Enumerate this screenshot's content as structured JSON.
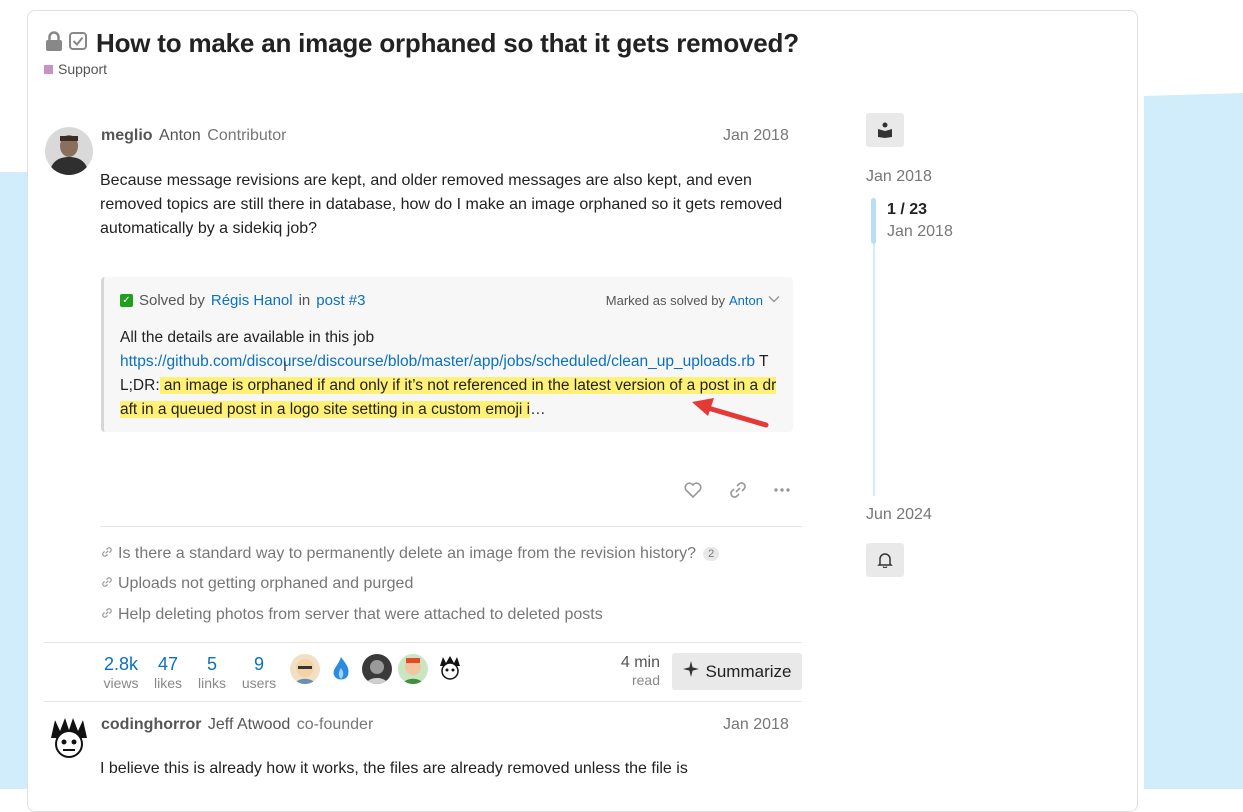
{
  "topic": {
    "title": "How to make an image orphaned so that it gets removed?",
    "category": "Support",
    "category_color": "#c891c8"
  },
  "post1": {
    "username": "meglio",
    "full_name": "Anton",
    "user_title": "Contributor",
    "date": "Jan 2018",
    "body": "Because message revisions are kept, and older removed messages are also kept, and even removed topics are still there in database, how do I make an image orphaned so it gets removed automatically by a sidekiq job?"
  },
  "solution": {
    "solved_by_label": "Solved by",
    "solver": "Régis Hanol",
    "in_label": "in",
    "post_ref": "post #3",
    "marked_label": "Marked as solved by",
    "marked_by": "Anton",
    "text_intro": "All the details are available in this job",
    "link": "https://github.com/discourse/discourse/blob/master/app/jobs/scheduled/clean_up_uploads.rb",
    "tldr": " TL;DR:",
    "highlight": " an image is orphaned if and only if it’s not referenced in the latest version of a post in a draft in a queued post in a logo site setting in a custom emoji i",
    "ellipsis": "…"
  },
  "related": [
    {
      "text": "Is there a standard way to permanently delete an image from the revision history?",
      "badge": "2"
    },
    {
      "text": "Uploads not getting orphaned and purged",
      "badge": ""
    },
    {
      "text": "Help deleting photos from server that were attached to deleted posts",
      "badge": ""
    }
  ],
  "stats": {
    "views": {
      "num": "2.8k",
      "label": "views"
    },
    "likes": {
      "num": "47",
      "label": "likes"
    },
    "links": {
      "num": "5",
      "label": "links"
    },
    "users": {
      "num": "9",
      "label": "users"
    },
    "read_num": "4 min",
    "read_label": "read",
    "summarize_label": "Summarize"
  },
  "post2": {
    "username": "codinghorror",
    "full_name": "Jeff Atwood",
    "user_title": "co-founder",
    "date": "Jan 2018",
    "body": "I believe this is already how it works, the files are already removed unless the file is"
  },
  "timeline": {
    "start_date": "Jan 2018",
    "position": "1 / 23",
    "position_date": "Jan 2018",
    "end_date": "Jun 2024"
  }
}
